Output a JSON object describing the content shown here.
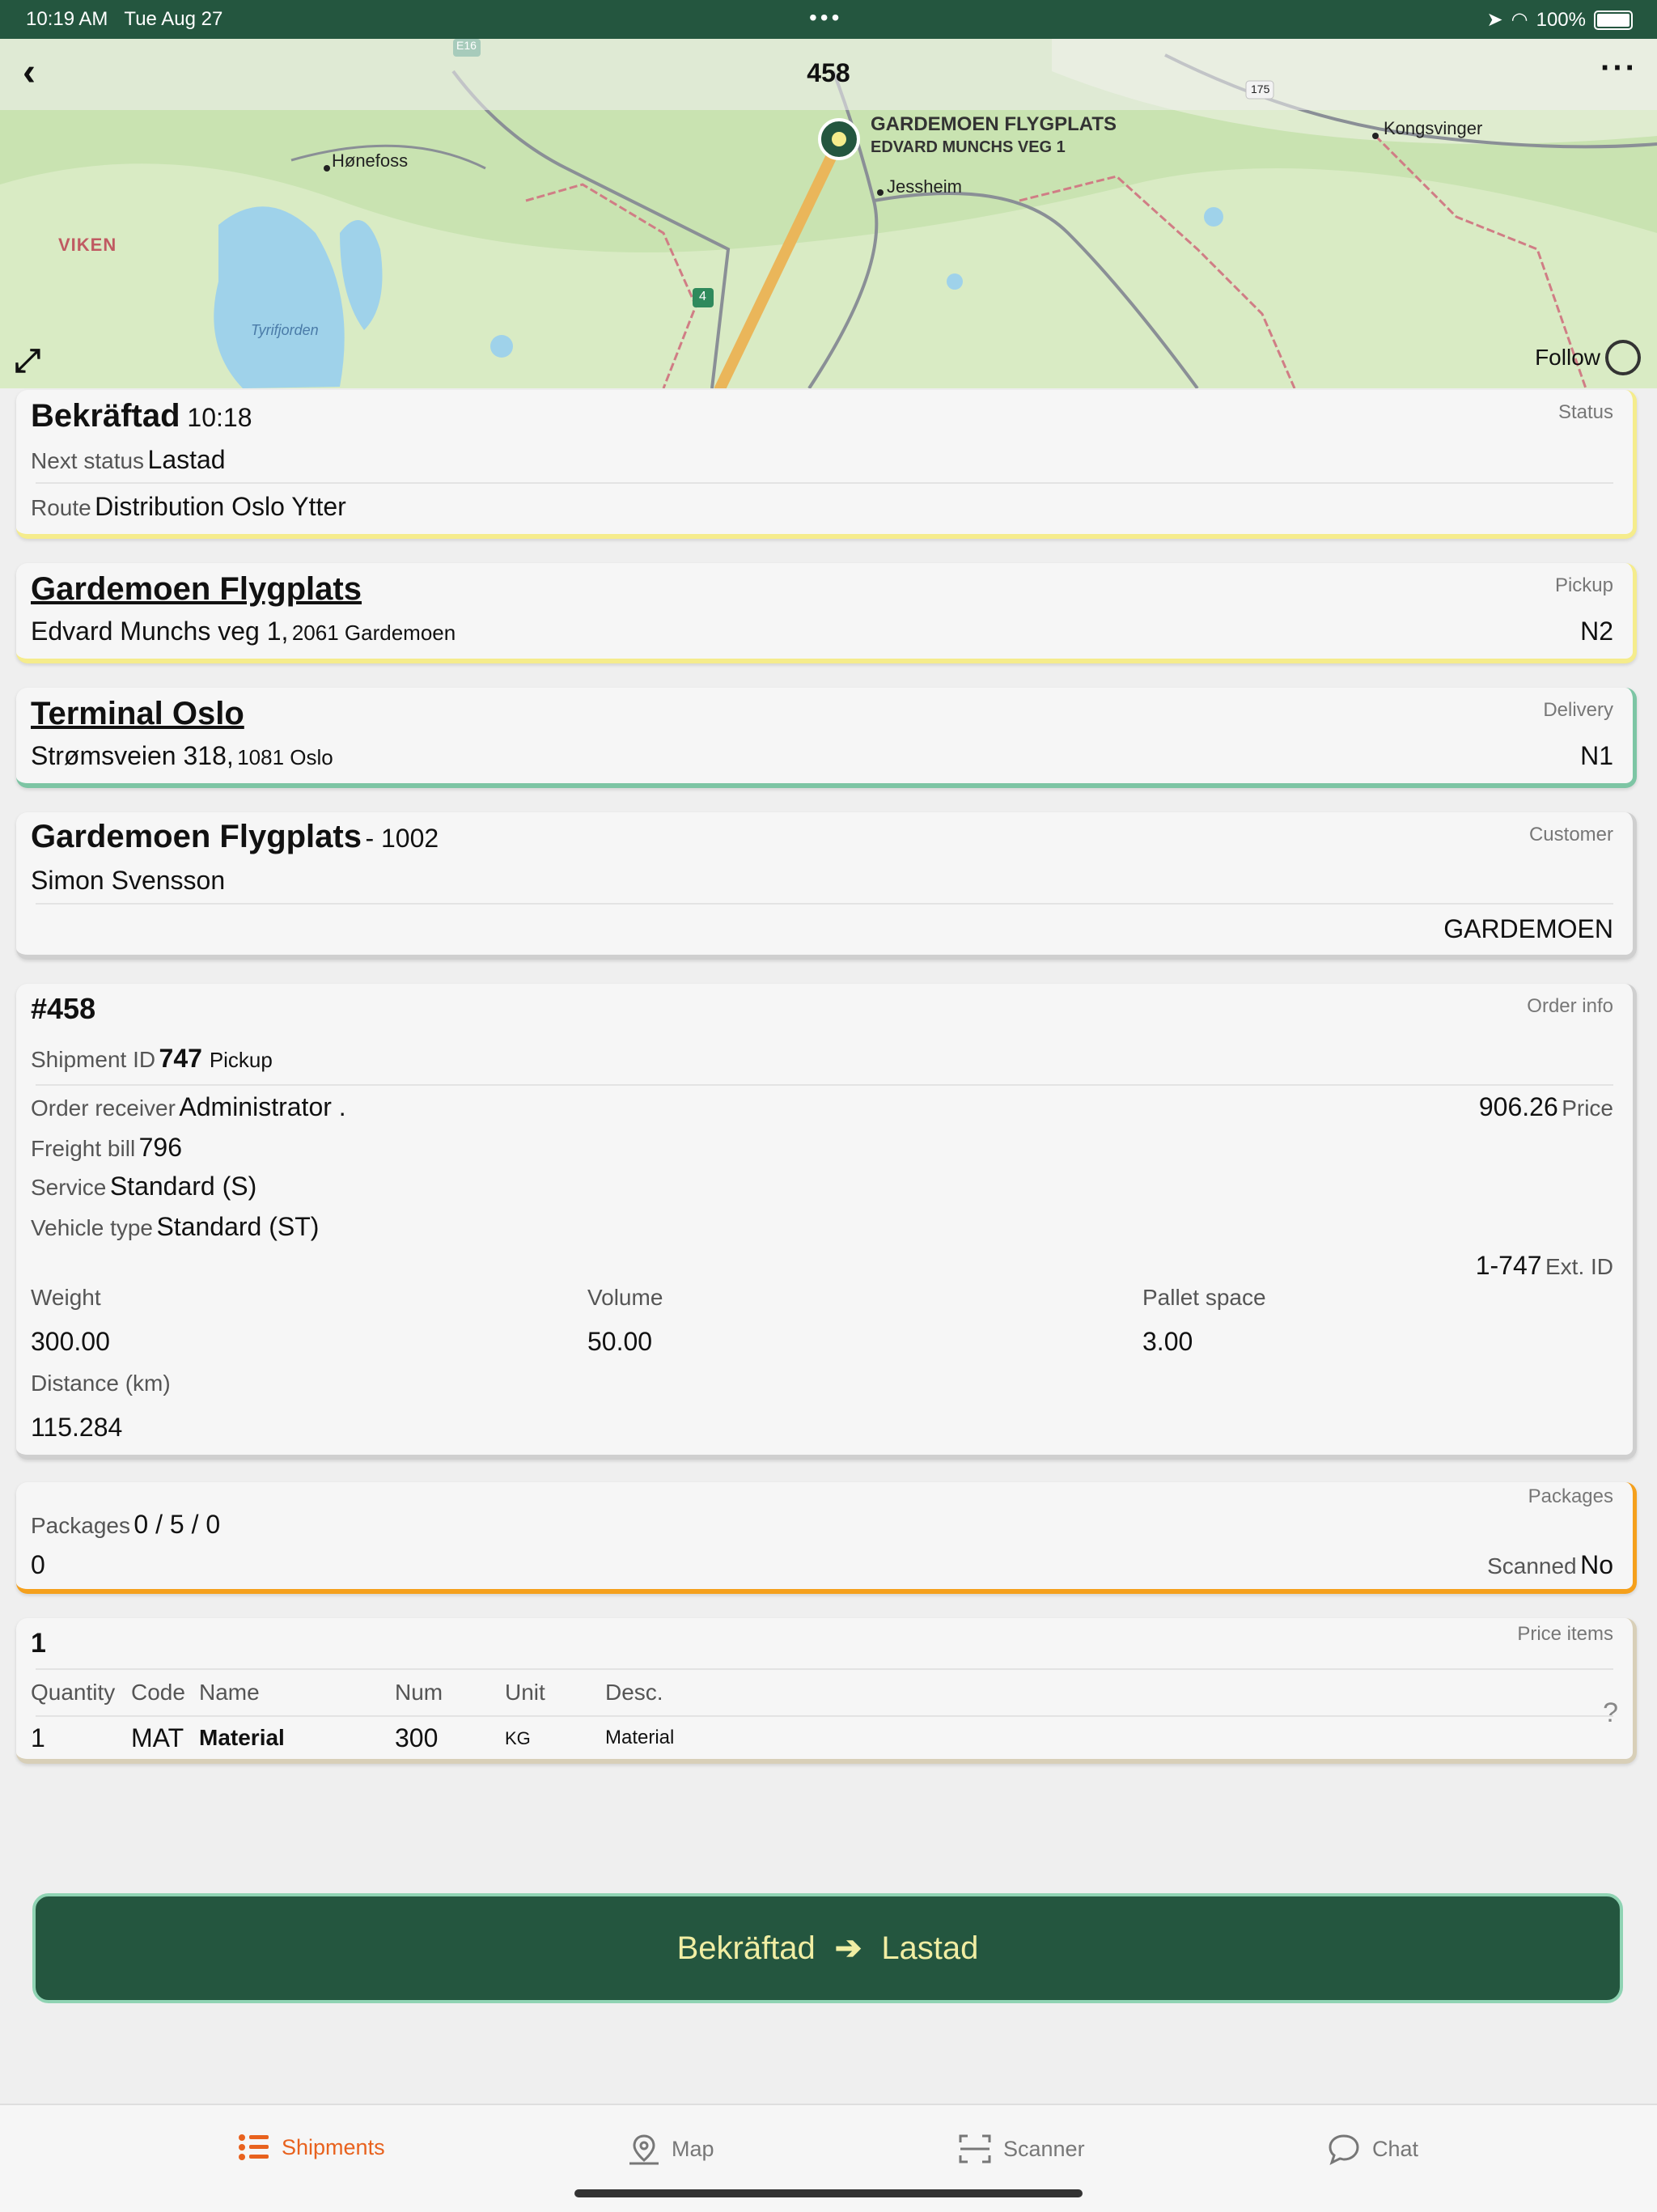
{
  "status_bar": {
    "time": "10:19 AM",
    "date": "Tue Aug 27",
    "battery": "100%"
  },
  "map": {
    "title": "458",
    "follow_label": "Follow",
    "labels": {
      "honefoss": "Hønefoss",
      "viken": "VIKEN",
      "tyrifjorden": "Tyrifjorden",
      "jessheim": "Jessheim",
      "kongsvinger": "Kongsvinger",
      "road_e16": "E16",
      "road_175": "175",
      "road_4": "4"
    },
    "poi_name": "GARDEMOEN FLYGPLATS",
    "poi_address": "EDVARD MUNCHS VEG 1"
  },
  "status_card": {
    "tag": "Status",
    "status": "Bekräftad",
    "time": "10:18",
    "next_status_label": "Next status",
    "next_status": "Lastad",
    "route_label": "Route",
    "route": "Distribution Oslo Ytter"
  },
  "pickup_card": {
    "tag": "Pickup",
    "name": "Gardemoen Flygplats",
    "street": "Edvard Munchs veg 1,",
    "postal": "2061 Gardemoen",
    "code": "N2"
  },
  "delivery_card": {
    "tag": "Delivery",
    "name": "Terminal Oslo",
    "street": "Strømsveien 318,",
    "postal": "1081 Oslo",
    "code": "N1"
  },
  "customer_card": {
    "tag": "Customer",
    "name": "Gardemoen Flygplats",
    "number": "- 1002",
    "contact": "Simon Svensson",
    "site": "GARDEMOEN"
  },
  "order_card": {
    "tag": "Order info",
    "order_no": "#458",
    "shipment_label": "Shipment ID",
    "shipment_id": "747",
    "shipment_type": "Pickup",
    "receiver_label": "Order receiver",
    "receiver": "Administrator .",
    "price": "906.26",
    "price_label": "Price",
    "freight_label": "Freight bill",
    "freight": "796",
    "service_label": "Service",
    "service": "Standard (S)",
    "vehicle_label": "Vehicle type",
    "vehicle": "Standard (ST)",
    "ext_id": "1-747",
    "ext_id_label": "Ext. ID",
    "weight_label": "Weight",
    "weight": "300.00",
    "volume_label": "Volume",
    "volume": "50.00",
    "pallet_label": "Pallet space",
    "pallet": "3.00",
    "distance_label": "Distance (km)",
    "distance": "115.284"
  },
  "packages_card": {
    "tag": "Packages",
    "label": "Packages",
    "value": "0 / 5 / 0",
    "count": "0",
    "scanned_label": "Scanned",
    "scanned": "No"
  },
  "price_card": {
    "tag": "Price items",
    "count": "1",
    "help": "?",
    "headers": {
      "quantity": "Quantity",
      "code": "Code",
      "name": "Name",
      "num": "Num",
      "unit": "Unit",
      "desc": "Desc."
    },
    "row": {
      "quantity": "1",
      "code": "MAT",
      "name": "Material",
      "num": "300",
      "unit": "KG",
      "desc": "Material"
    }
  },
  "action": {
    "from": "Bekräftad",
    "to": "Lastad"
  },
  "tabs": {
    "shipments": "Shipments",
    "map": "Map",
    "scanner": "Scanner",
    "chat": "Chat"
  },
  "colors": {
    "brand": "#24563f",
    "accent": "#e8621e",
    "button_text": "#f1eea3"
  }
}
